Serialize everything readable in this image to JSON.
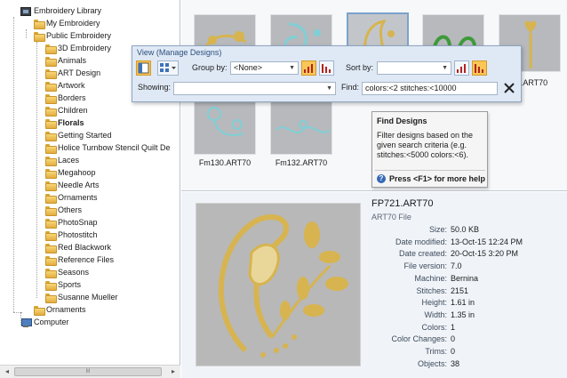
{
  "tree": {
    "root": "Embroidery Library",
    "my_embroidery": "My Embroidery",
    "public_embroidery": "Public Embroidery",
    "children": [
      "3D Embroidery",
      "Animals",
      "ART Design",
      "Artwork",
      "Borders",
      "Children",
      "Florals",
      "Getting Started",
      "Holice Turnbow Stencil Quilt De",
      "Laces",
      "Megahoop",
      "Needle Arts",
      "Ornaments",
      "Others",
      "PhotoSnap",
      "Photostitch",
      "Red Blackwork",
      "Reference Files",
      "Seasons",
      "Sports",
      "Susanne Mueller"
    ],
    "selected": "Florals",
    "ornaments": "Ornaments",
    "computer": "Computer"
  },
  "scrollbar": {
    "left": "◂",
    "right": "▸",
    "grip": "III"
  },
  "gallery": {
    "thumbs": [
      {
        "label": "",
        "selected": false
      },
      {
        "label": "",
        "selected": false
      },
      {
        "label": "",
        "selected": true
      },
      {
        "label": "",
        "selected": false
      },
      {
        "label": "20.ART70",
        "selected": false
      },
      {
        "label": "Fm130.ART70",
        "selected": false
      },
      {
        "label": "Fm132.ART70",
        "selected": false
      }
    ]
  },
  "toolbar": {
    "title": "View (Manage Designs)",
    "group_by_label": "Group by:",
    "group_by_value": "<None>",
    "sort_by_label": "Sort by:",
    "sort_by_value": "",
    "showing_label": "Showing:",
    "showing_value": "",
    "find_label": "Find:",
    "find_value": "colors:<2 stitches:<10000"
  },
  "tooltip": {
    "title": "Find Designs",
    "body": "Filter designs based on the given search criteria (e.g. stitches:<5000 colors:<6).",
    "help": "Press <F1> for more help"
  },
  "details": {
    "filename": "FP721.ART70",
    "filetype": "ART70 File",
    "props": [
      {
        "label": "Size:",
        "value": "50.0 KB"
      },
      {
        "label": "Date modified:",
        "value": "13-Oct-15 12:24 PM"
      },
      {
        "label": "Date created:",
        "value": "20-Oct-15 3:20 PM"
      },
      {
        "label": "File version:",
        "value": "7.0"
      },
      {
        "label": "Machine:",
        "value": "Bernina"
      },
      {
        "label": "Stitches:",
        "value": "2151"
      },
      {
        "label": "Height:",
        "value": "1.61 in"
      },
      {
        "label": "Width:",
        "value": "1.35 in"
      },
      {
        "label": "Colors:",
        "value": "1"
      },
      {
        "label": "Color Changes:",
        "value": "0"
      },
      {
        "label": "Trims:",
        "value": "0"
      },
      {
        "label": "Objects:",
        "value": "38"
      }
    ]
  },
  "colors": {
    "gold": "#d7b44f",
    "teal": "#7fcfd6",
    "green": "#3e9a3a",
    "accent_orange": "#f6a623",
    "panel_blue": "#dfe9f5"
  }
}
